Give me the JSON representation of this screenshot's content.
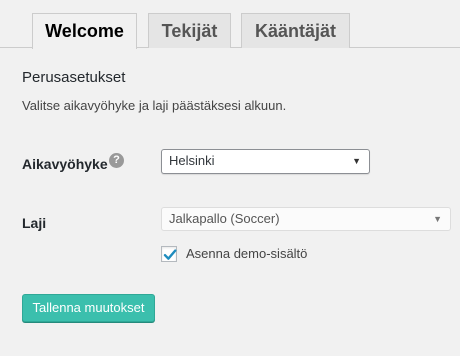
{
  "tabs": [
    {
      "label": "Welcome",
      "active": true
    },
    {
      "label": "Tekijät",
      "active": false
    },
    {
      "label": "Kääntäjät",
      "active": false
    }
  ],
  "settings": {
    "section_title": "Perusasetukset",
    "description": "Valitse aikavyöhyke ja laji päästäksesi alkuun.",
    "timezone": {
      "label": "Aikavyöhyke",
      "help_icon": "?",
      "value": "Helsinki"
    },
    "sport": {
      "label": "Laji",
      "value": "Jalkapallo (Soccer)"
    },
    "demo_content": {
      "label": "Asenna demo-sisältö",
      "checked": true
    },
    "save_label": "Tallenna muutokset"
  },
  "colors": {
    "accent": "#3bbfad",
    "check": "#1e8cbe",
    "background": "#f1f1f1"
  },
  "icons": {
    "help": "question-circle-icon",
    "dropdown": "triangle-down-icon",
    "check": "checkmark-icon"
  }
}
